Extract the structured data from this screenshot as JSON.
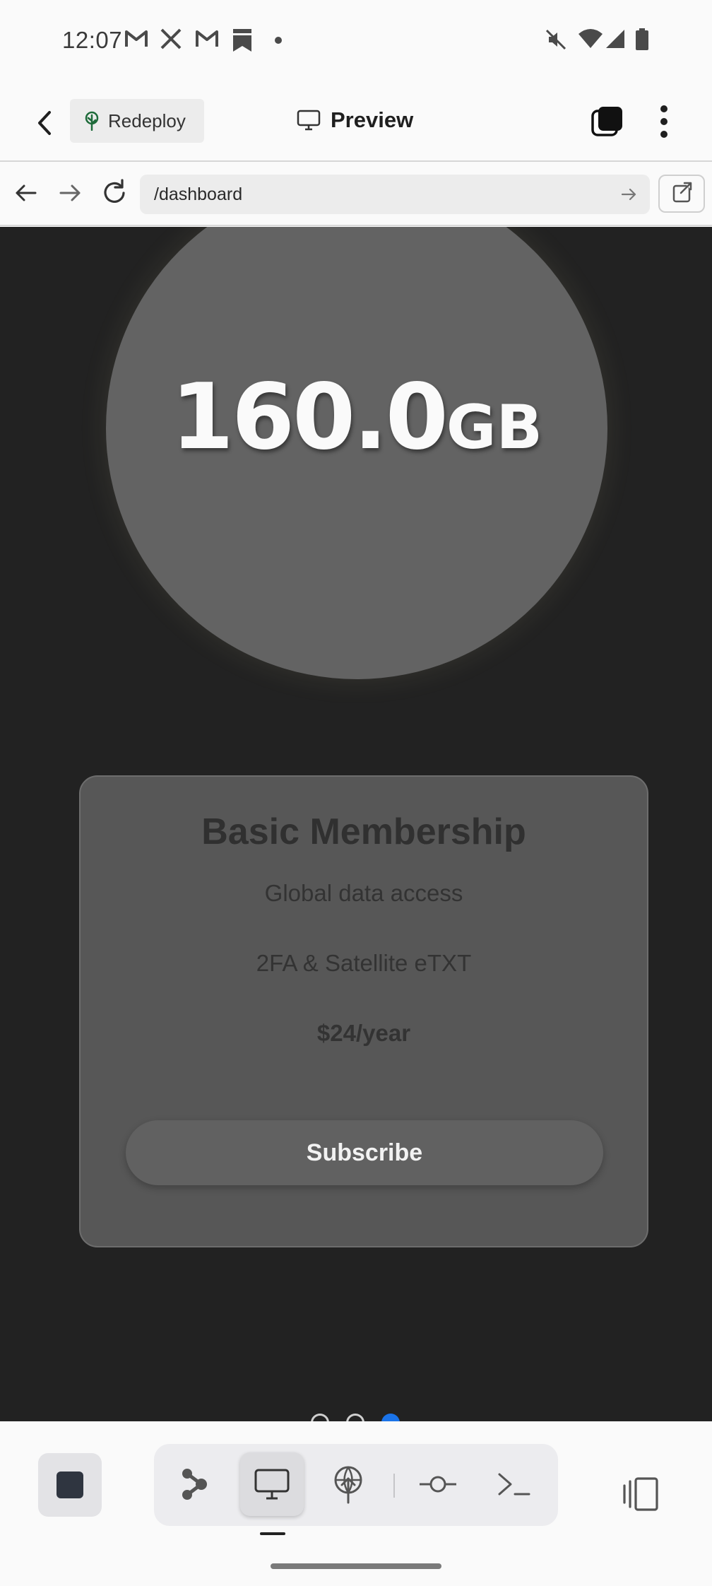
{
  "status_bar": {
    "time": "12:07",
    "notification_icons": [
      "gmail-icon",
      "x-icon",
      "gmail-icon",
      "bookmark-icon",
      "dot-icon"
    ],
    "system_icons": [
      "mute-icon",
      "wifi-icon",
      "signal-icon",
      "battery-icon"
    ]
  },
  "app_bar": {
    "redeploy_label": "Redeploy",
    "preview_label": "Preview"
  },
  "url_bar": {
    "url": "/dashboard"
  },
  "page": {
    "storage": {
      "value": "160.0",
      "unit": "GB"
    },
    "plan": {
      "title": "Basic Membership",
      "features": [
        "Global data access",
        "2FA & Satellite eTXT"
      ],
      "price": "$24/year",
      "cta_label": "Subscribe"
    },
    "carousel": {
      "count": 3,
      "active_index": 2
    }
  },
  "colors": {
    "page_background": "#222222",
    "circle": "#636363",
    "card": "#575757",
    "carousel_active": "#1a73e8"
  },
  "bottom_toolbar": {
    "icons": [
      "stop-icon",
      "graph-icon",
      "monitor-icon",
      "deploy-icon",
      "commit-icon",
      "terminal-icon",
      "panel-toggle-icon"
    ],
    "active_tool": "monitor-icon"
  }
}
